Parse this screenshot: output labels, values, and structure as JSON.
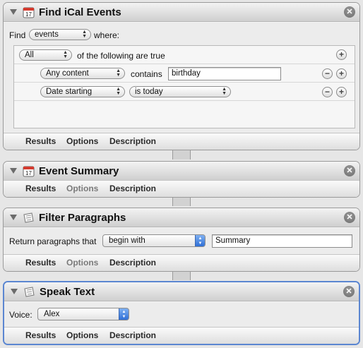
{
  "actions": {
    "find_ical": {
      "title": "Find iCal Events",
      "icon": "calendar-icon",
      "find_label": "Find",
      "find_value": "events",
      "where_label": "where:",
      "match_value": "All",
      "match_suffix": "of the following are true",
      "criteria": [
        {
          "field": "Any content",
          "operator": "contains",
          "value": "birthday"
        },
        {
          "field": "Date starting",
          "operator": "is today",
          "value": ""
        }
      ],
      "tabs": [
        "Results",
        "Options",
        "Description"
      ]
    },
    "event_summary": {
      "title": "Event Summary",
      "icon": "calendar-icon",
      "tabs": [
        "Results",
        "Options",
        "Description"
      ]
    },
    "filter_paragraphs": {
      "title": "Filter Paragraphs",
      "icon": "text-document-icon",
      "return_label": "Return paragraphs that",
      "condition_value": "begin with",
      "text_value": "Summary",
      "tabs": [
        "Results",
        "Options",
        "Description"
      ]
    },
    "speak_text": {
      "title": "Speak Text",
      "icon": "text-document-icon",
      "voice_label": "Voice:",
      "voice_value": "Alex",
      "tabs": [
        "Results",
        "Options",
        "Description"
      ]
    }
  },
  "glyphs": {
    "close": "✕",
    "plus": "+",
    "minus": "−",
    "up_down": "▲▼"
  },
  "colors": {
    "selected_border": "#5b86d1",
    "popup_accent": "#2f6fd6"
  }
}
